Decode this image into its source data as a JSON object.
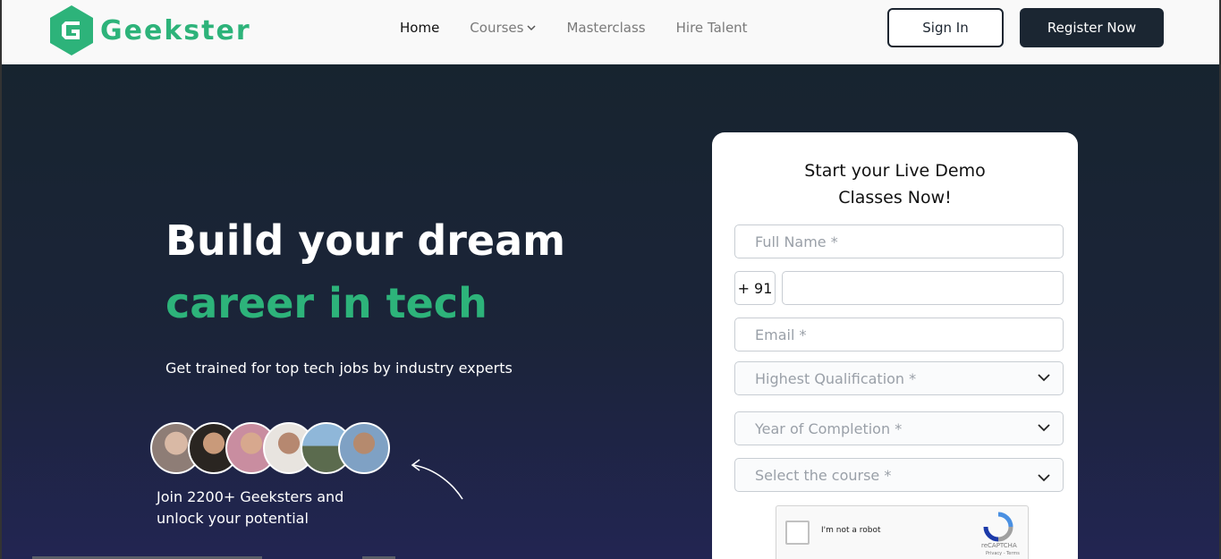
{
  "header": {
    "brand": "Geekster",
    "brand_color": "#2db37a",
    "nav": [
      {
        "label": "Home",
        "active": true
      },
      {
        "label": "Courses",
        "has_dropdown": true
      },
      {
        "label": "Masterclass"
      },
      {
        "label": "Hire Talent"
      }
    ],
    "signin_label": "Sign In",
    "register_label": "Register Now"
  },
  "hero": {
    "title_line1": "Build your dream",
    "title_line2": "career in tech",
    "subtitle": "Get trained for top tech jobs by industry experts",
    "join_line1": "Join 2200+ Geeksters and",
    "join_line2": "unlock your potential",
    "avatar_count": 6
  },
  "form": {
    "title_line1": "Start your Live Demo",
    "title_line2": "Classes Now!",
    "full_name_placeholder": "Full Name *",
    "country_code": "+ 91",
    "phone_value": "",
    "email_placeholder": "Email *",
    "qualification_placeholder": "Highest Qualification *",
    "year_placeholder": "Year of Completion *",
    "course_placeholder": "Select the course *",
    "captcha_label": "I'm not a robot",
    "captcha_brand": "reCAPTCHA",
    "captcha_terms": "Privacy - Terms"
  }
}
